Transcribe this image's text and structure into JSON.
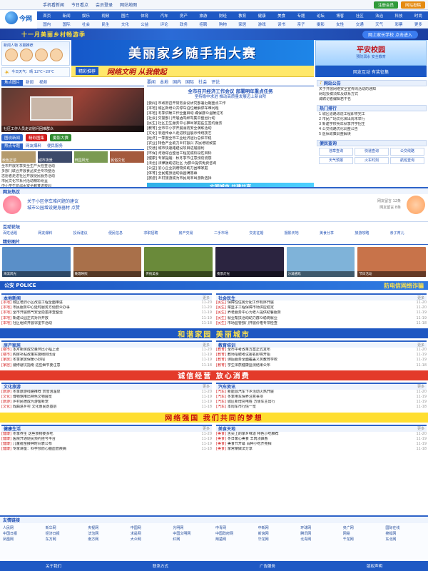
{
  "topbar": {
    "links": [
      "手机看新闻",
      "今日看点",
      "会员登录",
      "网站地图"
    ],
    "buttons": [
      {
        "label": "注册会员",
        "color": "#2f9a3a"
      },
      {
        "label": "网站投稿",
        "color": "#e58a10"
      }
    ]
  },
  "logo": {
    "text": "今网"
  },
  "nav": {
    "row1": [
      "首页",
      "新闻",
      "娱乐",
      "视频",
      "图片",
      "体育",
      "汽车",
      "房产",
      "旅游",
      "财经",
      "教育",
      "健康",
      "美食",
      "专题",
      "论坛",
      "博客",
      "社区",
      "法治",
      "科技",
      "时尚"
    ],
    "row2": [
      "国内",
      "国际",
      "社会",
      "民生",
      "文化",
      "公益",
      "评论",
      "政务",
      "招聘",
      "购物",
      "家居",
      "游戏",
      "读书",
      "亲子",
      "摄影",
      "女性",
      "交通",
      "天气",
      "彩票",
      "更多"
    ]
  },
  "banner": {
    "left": "十一月美丽乡村畅游季",
    "right": "网上家长学校 点击进入"
  },
  "hero": {
    "left_caption": "新闻人物 本期推荐",
    "main_title": "美丽家乡随手拍大赛",
    "right_title": "平安校园",
    "right_sub": "预防溺水 安全教育"
  },
  "subbanner": {
    "badge": "精彩推荐",
    "text": "网络文明 从我做起"
  },
  "weather": {
    "text": "今日天气：晴 12℃~20℃"
  },
  "side_ad": {
    "text": "网友互动 有奖征集"
  },
  "left_panel": {
    "tabs": [
      "焦点图片",
      "新闻",
      "视频"
    ],
    "photo_caption": "社区工作人员走访慰问困难群众",
    "pills": [
      {
        "label": "图说新闻",
        "color": "#2d63c8"
      },
      {
        "label": "精彩图集",
        "color": "#d21b1b"
      },
      {
        "label": "摄影大赛",
        "color": "#2f8a2f"
      }
    ],
    "extra_tabs": [
      "热点专题",
      "网友爆料",
      "便民服务"
    ],
    "thumbs": [
      "秋色正浓",
      "城市夜景",
      "田园风光",
      "民俗文化"
    ],
    "list": [
      "全市开展冬季安全生产大检查活动",
      "多部门联合开展食品安全专项整治",
      "志愿者走进社区开展便民服务活动",
      "市民文化节系列活动精彩纷呈",
      "中小学生防溺水安全教育进校园",
      "全市秋冬季重点项目集中开工"
    ]
  },
  "center": {
    "headline": "全市召开经济工作会议 部署明年重点任务",
    "subheadline": "坚持稳中求进 推动高质量发展迈上新台阶",
    "tag_links": [
      "要闻",
      "本地",
      "国内",
      "国际",
      "社会",
      "评论"
    ],
    "news": [
      "[要闻] 市政府召开常务会议研究部署近期重点工作",
      "[本地] 城区新增公共停车泊位缓解停车难问题",
      "[本地] 冬季供暖工作全面启动 确保群众温暖过冬",
      "[社会] 交警部门开展酒驾醉驾集中整治行动",
      "[民生] 社区卫生服务中心推出家庭医生签约服务",
      "[教育] 全市中小学开展消防安全演练活动",
      "[文化] 非遗传承人走进校园展示传统技艺",
      "[经济] 一季度全市工业经济运行总体平稳",
      "[农业] 特色产业助力乡村振兴 农民增收致富",
      "[交通] 城市快速路建设项目进展顺利",
      "[环保] 河道综合整治工程完成阶段性目标",
      "[健康] 专家提醒：秋冬季节注意预防流感",
      "[法治] 法律援助进社区 为群众提供免费咨询",
      "[公益] 爱心企业捐赠物资助力困难家庭",
      "[体育] 全民健身运动会圆满落幕",
      "[旅游] 乡村旅游成为市民周末出游新选择"
    ],
    "ad": "文明城市 共建共享"
  },
  "right_panel": {
    "box1_title": "网站公告",
    "box1_items": [
      "关于开展网络安全宣传周活动的通知",
      "网站投稿须知及联系方式",
      "诚聘记者编辑若干名"
    ],
    "box2_title": "热门排行",
    "box2_items": [
      "1 城区道路改造工程即将完工",
      "2 市民广场文化演出周末举行",
      "3 新建学校明年秋季开学招生",
      "4 公交线路优化调整公告",
      "5 医保政策调整解读"
    ],
    "box3_title": "便民查询",
    "box3_items": [
      "违章查询",
      "快递查询",
      "公交线路",
      "天气预报",
      "火车时刻",
      "航班查询"
    ]
  },
  "comments": {
    "head": "网友热议",
    "items": [
      {
        "title": "关于小区停车难问题的建议",
        "meta": "网友留言 12条"
      },
      {
        "title": "城市公园增设健身器材 点赞",
        "meta": "网友留言 8条"
      }
    ]
  },
  "quicklinks": {
    "head": "互动论坛",
    "items": [
      "百姓话题",
      "网友爆料",
      "投诉建议",
      "便民信息",
      "求职招聘",
      "房产交易",
      "二手市场",
      "交友征婚",
      "摄影天地",
      "美食分享",
      "旅游攻略",
      "亲子育儿"
    ]
  },
  "gallery": {
    "head": "精彩图片",
    "items": [
      {
        "caption": "海滨风光",
        "color": "#5a8fc8"
      },
      {
        "caption": "晚霞映照",
        "color": "#a9704a"
      },
      {
        "caption": "传统美食",
        "color": "#6a8a3a"
      },
      {
        "caption": "夜景灯光",
        "color": "#2b2440"
      },
      {
        "caption": "沙滩嬉戏",
        "color": "#7fb3d9"
      },
      {
        "caption": "节日活动",
        "color": "#c8734a"
      }
    ]
  },
  "police": {
    "head": "公安 POLICE",
    "ad": "防电信网络诈骗"
  },
  "sections": [
    {
      "left": {
        "title": "本地新闻",
        "more": "更多",
        "items": [
          {
            "cat": "[本地]",
            "t": "城区老旧小区改造工程全面推进",
            "d": "11-20"
          },
          {
            "cat": "[本地]",
            "t": "市民服务中心延时服务方便群众办事",
            "d": "11-20"
          },
          {
            "cat": "[本地]",
            "t": "全市开展燃气安全隐患排查整治",
            "d": "11-19"
          },
          {
            "cat": "[本地]",
            "t": "新建公园正式对外开放",
            "d": "11-19"
          },
          {
            "cat": "[本地]",
            "t": "社区组织开展邻里节活动",
            "d": "11-18"
          }
        ]
      },
      "right": {
        "title": "社会民生",
        "more": "更多",
        "items": [
          {
            "cat": "[民生]",
            "t": "保障性住房分配工作有序开展",
            "d": "11-20"
          },
          {
            "cat": "[民生]",
            "t": "菜篮子工程保障市场供应稳定",
            "d": "11-20"
          },
          {
            "cat": "[民生]",
            "t": "养老服务中心为老人提供助餐服务",
            "d": "11-19"
          },
          {
            "cat": "[民生]",
            "t": "就业帮扶活动助力群众稳岗就业",
            "d": "11-19"
          },
          {
            "cat": "[民生]",
            "t": "市场监管部门开展价格专项检查",
            "d": "11-18"
          }
        ]
      }
    },
    {
      "left": {
        "title": "房产家居",
        "more": "更多",
        "items": [
          {
            "cat": "[楼市]",
            "t": "本月新房成交量环比小幅上涨",
            "d": "11-20"
          },
          {
            "cat": "[楼市]",
            "t": "购房补贴政策实施细则出台",
            "d": "11-19"
          },
          {
            "cat": "[家居]",
            "t": "冬季家居保暖小妙招",
            "d": "11-19"
          },
          {
            "cat": "[家居]",
            "t": "装修避坑指南 这些细节要注意",
            "d": "11-18"
          }
        ]
      },
      "right": {
        "title": "教育培训",
        "more": "更多",
        "items": [
          {
            "cat": "[教育]",
            "t": "全市中考改革方案正式发布",
            "d": "11-20"
          },
          {
            "cat": "[教育]",
            "t": "教师招聘考试报名即将开始",
            "d": "11-19"
          },
          {
            "cat": "[教育]",
            "t": "课后服务全面覆盖义务教育学校",
            "d": "11-19"
          },
          {
            "cat": "[教育]",
            "t": "学生体质健康监测结果公布",
            "d": "11-18"
          }
        ]
      }
    },
    {
      "left": {
        "title": "文化旅游",
        "more": "更多",
        "items": [
          {
            "cat": "[旅游]",
            "t": "冬季旅游线路推荐 赏雪泡温泉",
            "d": "11-20"
          },
          {
            "cat": "[文化]",
            "t": "博物馆推出特色文物展览",
            "d": "11-19"
          },
          {
            "cat": "[旅游]",
            "t": "乡村民宿成为游客新宠",
            "d": "11-19"
          },
          {
            "cat": "[文化]",
            "t": "戏曲进乡村 文化惠民走基层",
            "d": "11-18"
          }
        ]
      },
      "right": {
        "title": "汽车资讯",
        "more": "更多",
        "items": [
          {
            "cat": "[汽车]",
            "t": "新能源汽车下乡活动火热开展",
            "d": "11-20"
          },
          {
            "cat": "[汽车]",
            "t": "冬季用车保养注意事项",
            "d": "11-19"
          },
          {
            "cat": "[汽车]",
            "t": "城区新增充电桩 方便车主出行",
            "d": "11-19"
          },
          {
            "cat": "[汽车]",
            "t": "本周车市行情一览",
            "d": "11-18"
          }
        ]
      }
    },
    {
      "left": {
        "title": "健康生活",
        "more": "更多",
        "items": [
          {
            "cat": "[健康]",
            "t": "冬季养生 这些食物要多吃",
            "d": "11-20"
          },
          {
            "cat": "[健康]",
            "t": "医院开通便民预约挂号平台",
            "d": "11-19"
          },
          {
            "cat": "[健康]",
            "t": "儿童疫苗接种时间表公布",
            "d": "11-19"
          },
          {
            "cat": "[健康]",
            "t": "专家讲座：科学预防心脑血管疾病",
            "d": "11-18"
          }
        ]
      },
      "right": {
        "title": "美食天地",
        "more": "更多",
        "items": [
          {
            "cat": "[美食]",
            "t": "舌尖上的家乡味道 特色小吃推荐",
            "d": "11-20"
          },
          {
            "cat": "[美食]",
            "t": "冬日暖心美食 羊肉汤飘香",
            "d": "11-19"
          },
          {
            "cat": "[美食]",
            "t": "美食节开幕 百种小吃齐亮相",
            "d": "11-19"
          },
          {
            "cat": "[美食]",
            "t": "家常菜做法分享",
            "d": "11-18"
          }
        ]
      }
    }
  ],
  "adbands": [
    {
      "text": "和谐家园 美丽城市",
      "bg": "#1e57c2",
      "color": "#ffe34b"
    },
    {
      "text": "诚信经营 放心消费",
      "bg": "#e33a2a",
      "color": "#ffffff"
    },
    {
      "text": "网络强国 我们共同的梦想",
      "bg": "#ffde30",
      "color": "#c81010"
    }
  ],
  "friends": {
    "head": "友情链接",
    "links": [
      "人民网",
      "新华网",
      "央视网",
      "中国网",
      "光明网",
      "中青网",
      "中新网",
      "环球网",
      "央广网",
      "国际在线",
      "中国日报",
      "经济日报",
      "法治网",
      "求是网",
      "中国文明网",
      "中国政府网",
      "新浪网",
      "腾讯网",
      "网易",
      "搜狐网",
      "凤凰网",
      "东方网",
      "南方网",
      "大众网",
      "红网",
      "荆楚网",
      "华龙网",
      "北青网",
      "千龙网",
      "东北网"
    ]
  },
  "footer": {
    "items": [
      "关于我们",
      "联系方式",
      "广告服务",
      "版权声明"
    ]
  }
}
